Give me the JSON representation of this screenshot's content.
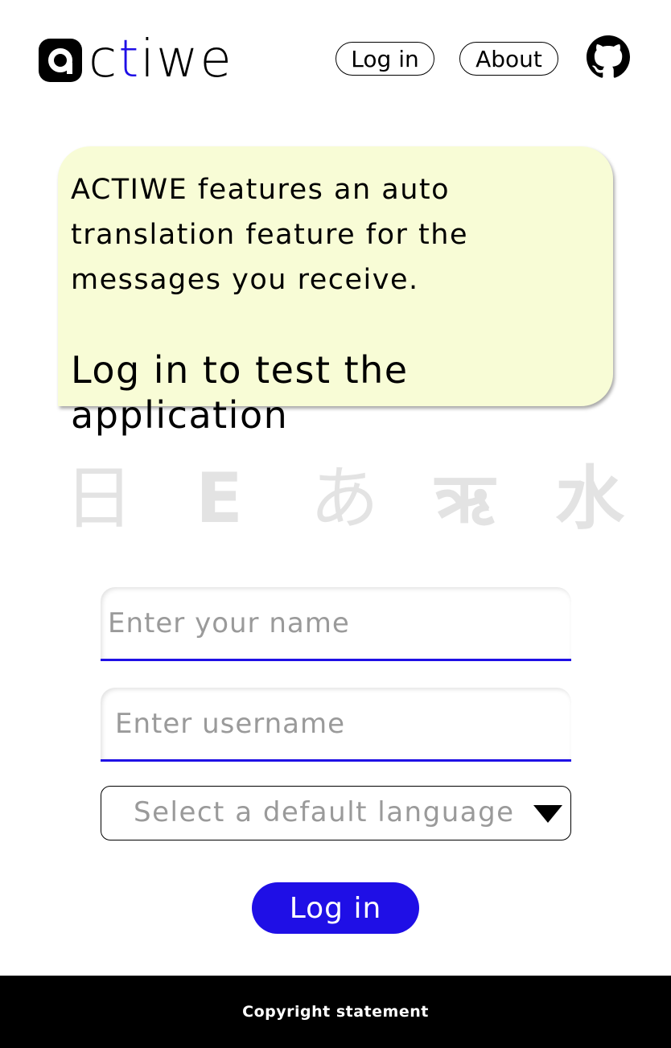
{
  "header": {
    "logo": {
      "prefix": "a",
      "text_before": "c",
      "text_accent": "t",
      "text_after": "iwe",
      "accent_color": "#1f0fe6"
    },
    "nav": {
      "login_label": "Log in",
      "about_label": "About"
    },
    "github_icon": "github-icon"
  },
  "info": {
    "description": "ACTIWE features an auto translation feature for the messages you receive.",
    "cta": "Log in to test the application",
    "background_color": "#f8fcd6"
  },
  "scripts": {
    "glyphs": [
      "日",
      "E",
      "あ",
      "ऋ",
      "水"
    ]
  },
  "form": {
    "name_placeholder": "Enter your name",
    "name_value": "",
    "username_placeholder": "Enter username",
    "username_value": "",
    "language_placeholder": "Select a default language",
    "submit_label": "Log in",
    "accent_color": "#1f0fe6"
  },
  "footer": {
    "copyright": "Copyright statement"
  }
}
